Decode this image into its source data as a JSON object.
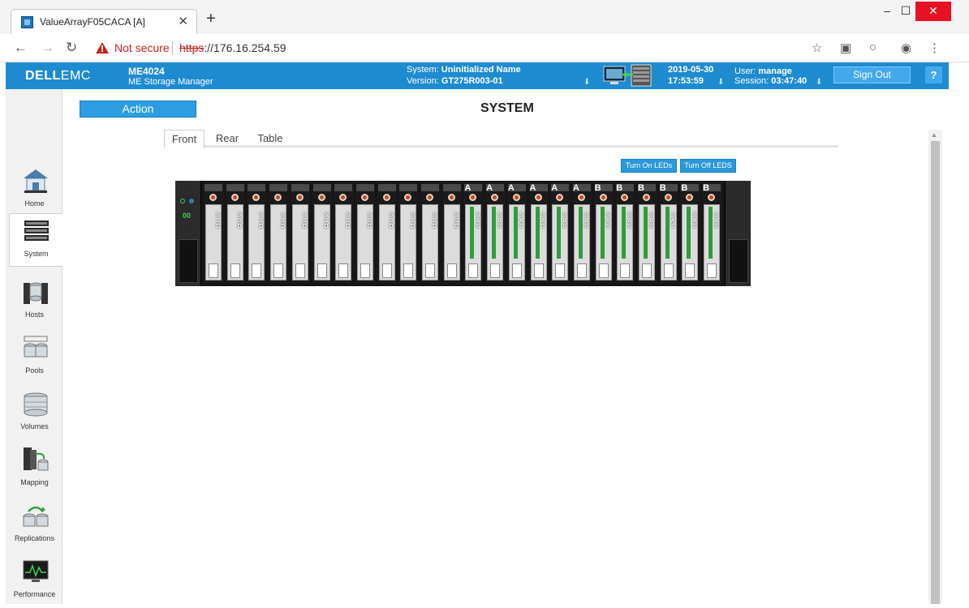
{
  "browser": {
    "tab_title": "ValueArrayF05CACA [A]",
    "security_label": "Not secure",
    "url_scheme": "https",
    "url_rest": "://176.16.254.59"
  },
  "header": {
    "brand_bold": "DELL",
    "brand_light": "EMC",
    "model": "ME4024",
    "product": "ME Storage Manager",
    "system_label": "System:",
    "system_name": "Uninitialized Name",
    "version_label": "Version:",
    "version": "GT275R003-01",
    "date": "2019-05-30",
    "time": "17:53:59",
    "user_label": "User:",
    "user": "manage",
    "session_label": "Session:",
    "session": "03:47:40",
    "sign_out": "Sign Out",
    "help": "?"
  },
  "sidebar": {
    "items": [
      {
        "label": "Home",
        "icon": "home-icon"
      },
      {
        "label": "System",
        "icon": "system-icon",
        "active": true
      },
      {
        "label": "Hosts",
        "icon": "hosts-icon"
      },
      {
        "label": "Pools",
        "icon": "pools-icon"
      },
      {
        "label": "Volumes",
        "icon": "volumes-icon"
      },
      {
        "label": "Mapping",
        "icon": "mapping-icon"
      },
      {
        "label": "Replications",
        "icon": "replications-icon"
      },
      {
        "label": "Performance",
        "icon": "performance-icon"
      }
    ]
  },
  "main": {
    "action": "Action",
    "title": "SYSTEM",
    "tabs": [
      "Front",
      "Rear",
      "Table"
    ],
    "active_tab": "Front",
    "led_on": "Turn On LEDs",
    "led_off": "Turn Off LEDS"
  },
  "enclosure": {
    "enclosure_id": "00",
    "drives": [
      {
        "type": "SSD",
        "group": ""
      },
      {
        "type": "SSD",
        "group": ""
      },
      {
        "type": "SSD",
        "group": ""
      },
      {
        "type": "SSD",
        "group": ""
      },
      {
        "type": "SSD",
        "group": ""
      },
      {
        "type": "SSD",
        "group": ""
      },
      {
        "type": "SSD",
        "group": ""
      },
      {
        "type": "SSD",
        "group": ""
      },
      {
        "type": "SSD",
        "group": ""
      },
      {
        "type": "SSD",
        "group": ""
      },
      {
        "type": "SSD",
        "group": ""
      },
      {
        "type": "SSD",
        "group": ""
      },
      {
        "type": "SAS",
        "group": "A"
      },
      {
        "type": "SAS",
        "group": "A"
      },
      {
        "type": "SAS",
        "group": "A"
      },
      {
        "type": "SAS",
        "group": "A"
      },
      {
        "type": "SAS",
        "group": "A"
      },
      {
        "type": "SAS",
        "group": "A"
      },
      {
        "type": "SAS",
        "group": "B"
      },
      {
        "type": "SAS",
        "group": "B"
      },
      {
        "type": "SAS",
        "group": "B"
      },
      {
        "type": "SAS",
        "group": "B"
      },
      {
        "type": "SAS",
        "group": "B"
      },
      {
        "type": "SAS",
        "group": "B"
      }
    ]
  },
  "colors": {
    "header_blue": "#1e8ad0",
    "button_blue": "#2b9de0",
    "warning_red": "#c5221f",
    "drive_green": "#2e9e3b"
  }
}
